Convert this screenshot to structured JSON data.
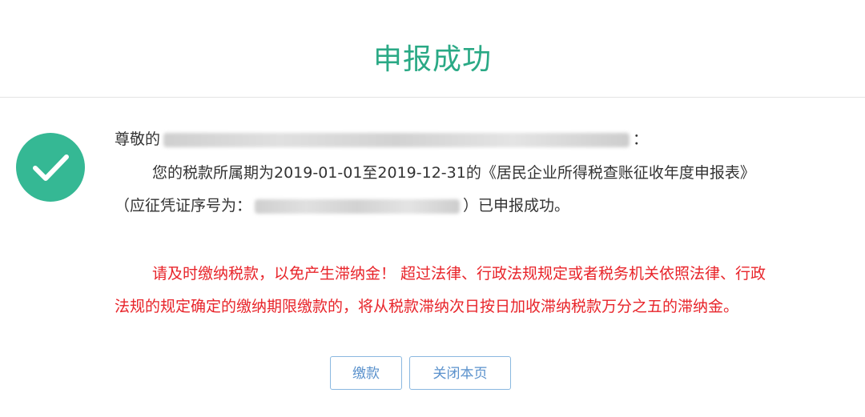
{
  "page": {
    "title": "申报成功"
  },
  "message": {
    "greeting_prefix": "尊敬的",
    "greeting_suffix": "：",
    "period_sentence": "您的税款所属期为2019-01-01至2019-12-31的《居民企业所得税查账征收年度申报表》",
    "voucher_prefix": "（应征凭证序号为：",
    "voucher_suffix": "）已申报成功。",
    "warning_line1": "请及时缴纳税款，以免产生滞纳金！ 超过法律、行政法规规定或者税务机关依照法律、行政",
    "warning_line2": "法规的规定确定的缴纳期限缴款的，将从税款滞纳次日按日加收滞纳税款万分之五的滞纳金。"
  },
  "buttons": {
    "pay_label": "缴款",
    "close_label": "关闭本页"
  },
  "icons": {
    "status": "check-circle-icon"
  },
  "colors": {
    "title": "#2aa985",
    "success_icon": "#35b894",
    "warning_text": "#e8242a",
    "button_text": "#5a91cc",
    "button_border": "#8ab8e0"
  }
}
